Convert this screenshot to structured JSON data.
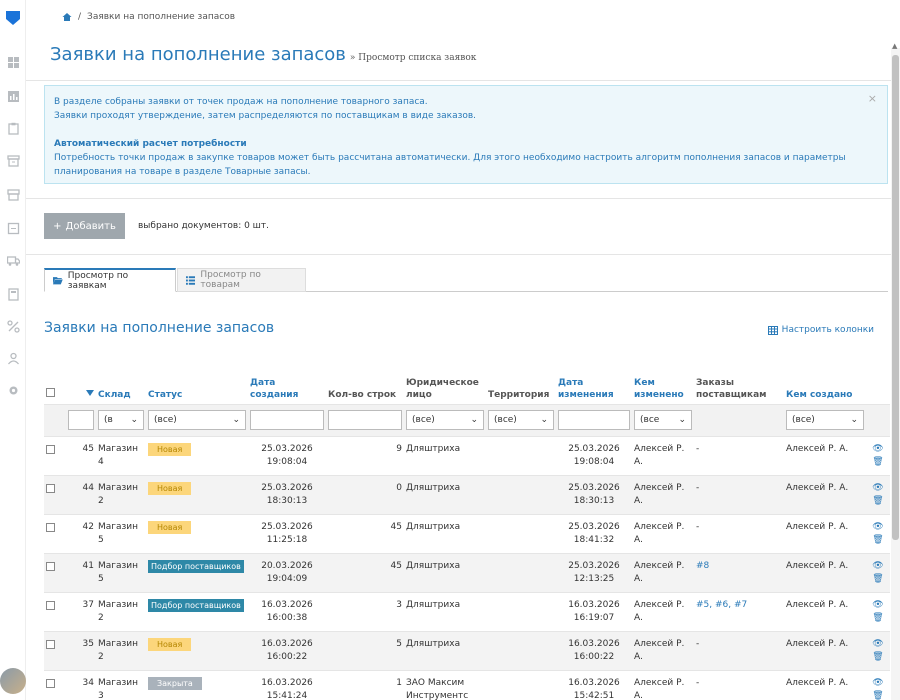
{
  "breadcrumb": {
    "current": "Заявки на пополнение запасов"
  },
  "page": {
    "title": "Заявки на пополнение запасов",
    "subtitle": "» Просмотр списка заявок"
  },
  "alert": {
    "line1": "В разделе собраны заявки от точек продаж на пополнение товарного запаса.",
    "line2": "Заявки проходят утверждение, затем распределяются по поставщикам в виде заказов.",
    "heading": "Автоматический расчет потребности",
    "line3": "Потребность точки продаж в закупке товаров может быть рассчитана автоматически. Для этого необходимо настроить алгоритм пополнения запасов и параметры",
    "line4": "планирования на товаре в разделе Товарные запасы.",
    "close": "×"
  },
  "toolbar": {
    "add_label": "Добавить",
    "selected_text": "выбрано документов: 0 шт."
  },
  "tabs": [
    {
      "label": "Просмотр по заявкам"
    },
    {
      "label": "Просмотр по товарам"
    }
  ],
  "section": {
    "title": "Заявки на пополнение запасов",
    "configure": "Настроить колонки"
  },
  "columns": {
    "warehouse": "Склад",
    "status": "Статус",
    "created": "Дата создания",
    "rows": "Кол-во строк",
    "legal": "Юридическое лицо",
    "territory": "Территория",
    "modified": "Дата изменения",
    "modified_by": "Кем изменено",
    "orders": "Заказы поставщикам",
    "created_by": "Кем создано"
  },
  "filters": {
    "warehouse": "(в",
    "status": "(все)",
    "legal": "(все)",
    "territory": "(все)",
    "modified_by": "(все",
    "created_by": "(все)"
  },
  "rows": [
    {
      "id": "45",
      "warehouse": "Магазин 4",
      "status": "Новая",
      "status_type": "new",
      "created_date": "25.03.2026",
      "created_time": "19:08:04",
      "rows": "9",
      "legal": "Дляштриха",
      "modified_date": "25.03.2026",
      "modified_time": "19:08:04",
      "modified_by": "Алексей Р. А.",
      "orders": "-",
      "created_by": "Алексей Р. А."
    },
    {
      "id": "44",
      "warehouse": "Магазин 2",
      "status": "Новая",
      "status_type": "new",
      "created_date": "25.03.2026",
      "created_time": "18:30:13",
      "rows": "0",
      "legal": "Дляштриха",
      "modified_date": "25.03.2026",
      "modified_time": "18:30:13",
      "modified_by": "Алексей Р. А.",
      "orders": "-",
      "created_by": "Алексей Р. А."
    },
    {
      "id": "42",
      "warehouse": "Магазин 5",
      "status": "Новая",
      "status_type": "new",
      "created_date": "25.03.2026",
      "created_time": "11:25:18",
      "rows": "45",
      "legal": "Дляштриха",
      "modified_date": "25.03.2026",
      "modified_time": "18:41:32",
      "modified_by": "Алексей Р. А.",
      "orders": "-",
      "created_by": "Алексей Р. А."
    },
    {
      "id": "41",
      "warehouse": "Магазин 5",
      "status": "Подбор поставщиков",
      "status_type": "sup",
      "created_date": "20.03.2026",
      "created_time": "19:04:09",
      "rows": "45",
      "legal": "Дляштриха",
      "modified_date": "25.03.2026",
      "modified_time": "12:13:25",
      "modified_by": "Алексей Р. А.",
      "orders": "#8",
      "created_by": "Алексей Р. А."
    },
    {
      "id": "37",
      "warehouse": "Магазин 2",
      "status": "Подбор поставщиков",
      "status_type": "sup",
      "created_date": "16.03.2026",
      "created_time": "16:00:38",
      "rows": "3",
      "legal": "Дляштриха",
      "modified_date": "16.03.2026",
      "modified_time": "16:19:07",
      "modified_by": "Алексей Р. А.",
      "orders": "#5, #6, #7",
      "created_by": "Алексей Р. А."
    },
    {
      "id": "35",
      "warehouse": "Магазин 2",
      "status": "Новая",
      "status_type": "new",
      "created_date": "16.03.2026",
      "created_time": "16:00:22",
      "rows": "5",
      "legal": "Дляштриха",
      "modified_date": "16.03.2026",
      "modified_time": "16:00:22",
      "modified_by": "Алексей Р. А.",
      "orders": "-",
      "created_by": "Алексей Р. А."
    },
    {
      "id": "34",
      "warehouse": "Магазин 3",
      "status": "Закрыта",
      "status_type": "cls",
      "created_date": "16.03.2026",
      "created_time": "15:41:24",
      "rows": "1",
      "legal": "ЗАО Максим Инструментс",
      "modified_date": "16.03.2026",
      "modified_time": "15:42:51",
      "modified_by": "Алексей Р. А.",
      "orders": "-",
      "created_by": "Алексей Р. А."
    }
  ],
  "colors": {
    "accent": "#2a7ab8",
    "new_badge": "#fcd67b",
    "supplier_badge": "#2e88a7",
    "closed_badge": "#a9b2bb"
  }
}
